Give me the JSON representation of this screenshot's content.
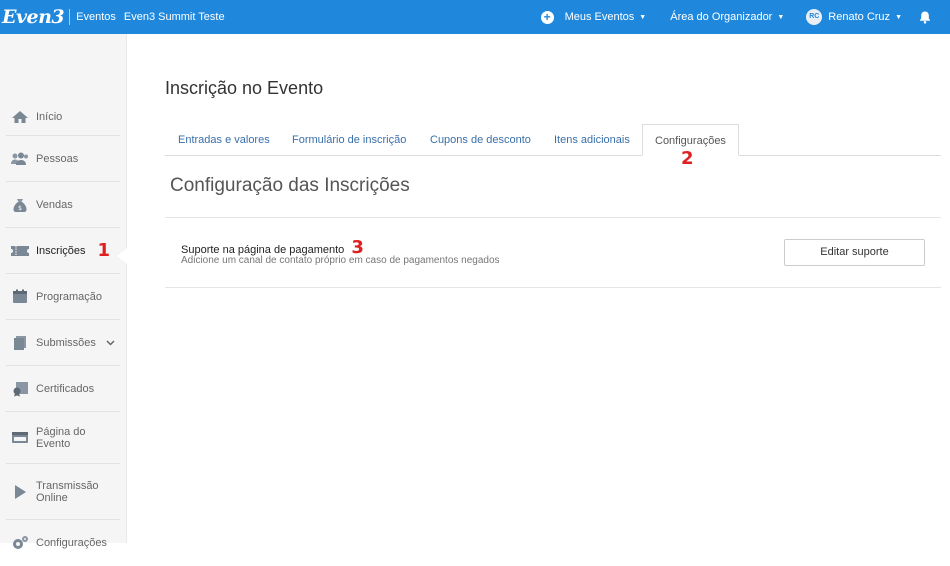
{
  "topbar": {
    "logo": "Even3",
    "eventos_label": "Eventos",
    "event_name": "Even3 Summit Teste",
    "meus_eventos_label": "Meus Eventos",
    "organizador_label": "Área do Organizador",
    "user_initials": "RC",
    "user_name": "Renato Cruz",
    "caret": "▼",
    "plus": "+"
  },
  "sidebar": {
    "items": [
      {
        "label": "Início",
        "icon": "home-icon"
      },
      {
        "label": "Pessoas",
        "icon": "people-icon"
      },
      {
        "label": "Vendas",
        "icon": "money-bag-icon"
      },
      {
        "label": "Inscrições",
        "icon": "ticket-icon",
        "marker": "1"
      },
      {
        "label": "Programação",
        "icon": "calendar-icon"
      },
      {
        "label": "Submissões",
        "icon": "documents-icon",
        "arrow": "⌄"
      },
      {
        "label": "Certificados",
        "icon": "certificate-icon"
      },
      {
        "label": "Página do Evento",
        "icon": "web-page-icon"
      },
      {
        "label": "Transmissão Online",
        "icon": "play-icon"
      },
      {
        "label": "Configurações",
        "icon": "settings-icon"
      }
    ]
  },
  "main": {
    "title": "Inscrição no Evento",
    "tabs": [
      {
        "label": "Entradas e valores"
      },
      {
        "label": "Formulário de inscrição"
      },
      {
        "label": "Cupons de desconto"
      },
      {
        "label": "Itens adicionais"
      },
      {
        "label": "Configurações",
        "marker": "2"
      }
    ],
    "section_title": "Configuração das Inscrições",
    "row": {
      "title": "Suporte na página de pagamento",
      "marker": "3",
      "description": "Adicione um canal de contato próprio em caso de pagamentos negados",
      "button_label": "Editar suporte"
    }
  },
  "colors": {
    "topbar": "#1f88dd",
    "marker": "#e02020",
    "link": "#3a6fa8"
  }
}
